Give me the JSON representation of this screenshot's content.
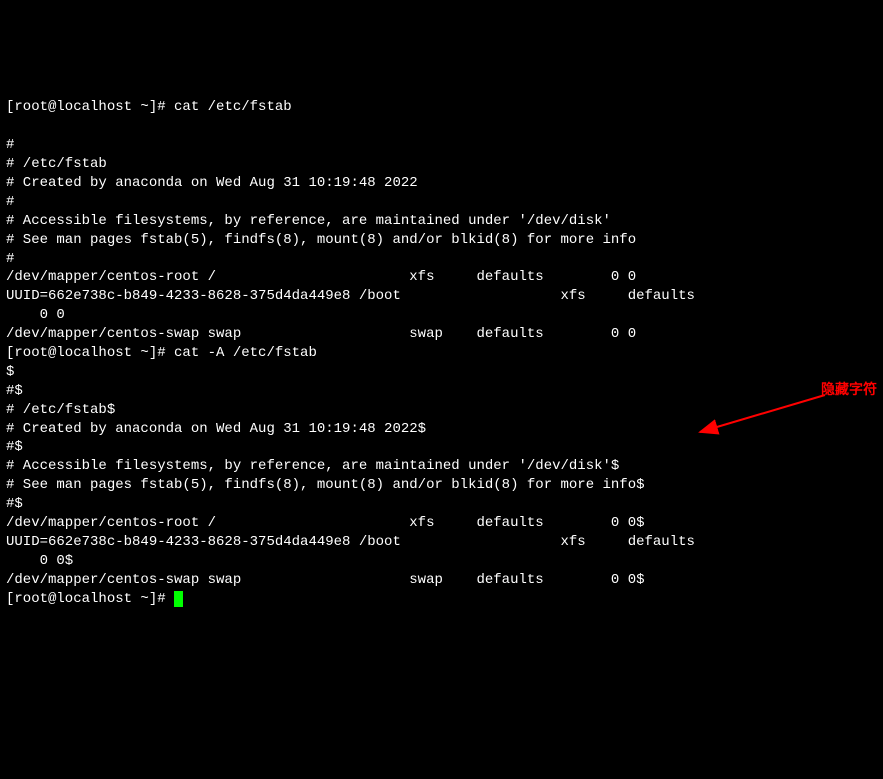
{
  "prompt1": "[root@localhost ~]# ",
  "cmd1": "cat /etc/fstab",
  "out1": [
    "",
    "#",
    "# /etc/fstab",
    "# Created by anaconda on Wed Aug 31 10:19:48 2022",
    "#",
    "# Accessible filesystems, by reference, are maintained under '/dev/disk'",
    "# See man pages fstab(5), findfs(8), mount(8) and/or blkid(8) for more info",
    "#",
    "/dev/mapper/centos-root /                       xfs     defaults        0 0",
    "UUID=662e738c-b849-4233-8628-375d4da449e8 /boot                   xfs     defaults   ",
    "    0 0",
    "/dev/mapper/centos-swap swap                    swap    defaults        0 0"
  ],
  "prompt2": "[root@localhost ~]# ",
  "cmd2": "cat -A /etc/fstab",
  "out2": [
    "$",
    "#$",
    "# /etc/fstab$",
    "# Created by anaconda on Wed Aug 31 10:19:48 2022$",
    "#$",
    "# Accessible filesystems, by reference, are maintained under '/dev/disk'$",
    "# See man pages fstab(5), findfs(8), mount(8) and/or blkid(8) for more info$",
    "#$",
    "/dev/mapper/centos-root /                       xfs     defaults        0 0$",
    "UUID=662e738c-b849-4233-8628-375d4da449e8 /boot                   xfs     defaults   ",
    "    0 0$",
    "/dev/mapper/centos-swap swap                    swap    defaults        0 0$"
  ],
  "prompt3": "[root@localhost ~]# ",
  "annotation": "隐藏字符"
}
